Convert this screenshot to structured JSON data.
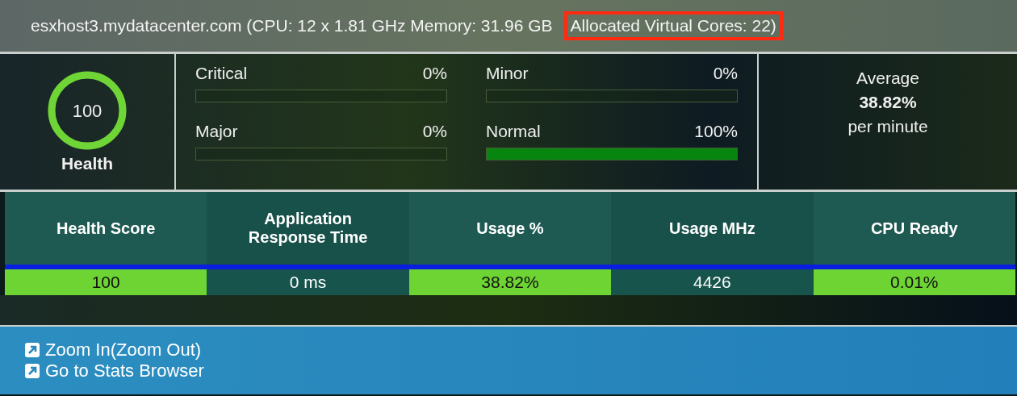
{
  "header": {
    "host_info": "esxhost3.mydatacenter.com (CPU: 12 x 1.81 GHz Memory: 31.96 GB",
    "allocated_cores": "Allocated Virtual Cores: 22)",
    "allocated_cores_highlighted": true
  },
  "health": {
    "score": "100",
    "label": "Health",
    "level": 1
  },
  "alarms": [
    {
      "label": "Critical",
      "value": "0%",
      "level": 0
    },
    {
      "label": "Minor",
      "value": "0%",
      "level": 0
    },
    {
      "label": "Major",
      "value": "0%",
      "level": 0
    },
    {
      "label": "Normal",
      "value": "100%",
      "level": 1
    }
  ],
  "average": {
    "title": "Average",
    "value": "38.82%",
    "unit": "per minute"
  },
  "table": {
    "columns": [
      "Health Score",
      "Application Response Time",
      "Usage %",
      "Usage MHz",
      "CPU Ready"
    ],
    "rows": [
      [
        {
          "text": "100",
          "color": "#6dd433"
        },
        {
          "text": "0 ms"
        },
        {
          "text": "38.82%",
          "color": "#6dd433"
        },
        {
          "text": "4426"
        },
        {
          "text": "0.01%",
          "color": "#6dd433"
        }
      ]
    ]
  },
  "links": [
    {
      "label": "Zoom In(Zoom Out)"
    },
    {
      "label": "Go to Stats Browser"
    }
  ]
}
